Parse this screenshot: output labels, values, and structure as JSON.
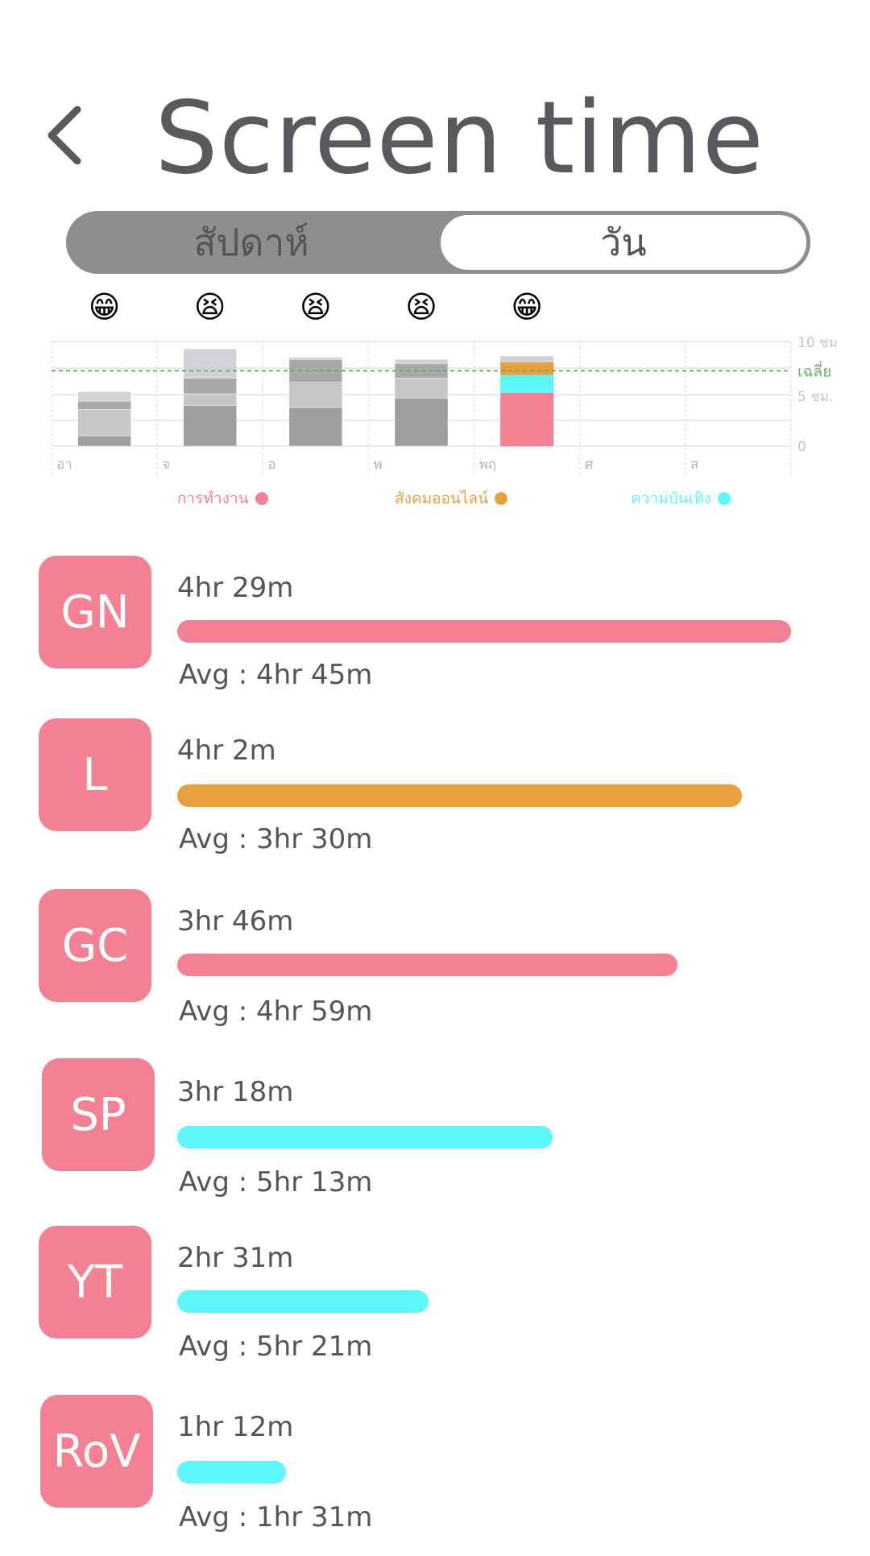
{
  "header": {
    "title": "Screen time",
    "back_icon": "chevron-left-icon"
  },
  "toggle": {
    "week_label": "สัปดาห์",
    "day_label": "วัน",
    "selected": "day"
  },
  "chart_data": {
    "type": "bar",
    "categories": [
      "อา",
      "จ",
      "อ",
      "พ",
      "พฤ",
      "ศ",
      "ส"
    ],
    "moods": [
      "😁",
      "😫",
      "😫",
      "😫",
      "😁",
      "",
      ""
    ],
    "y_unit": "ชม",
    "ylim": [
      0,
      10
    ],
    "y_ticks": [
      "10 ชม",
      "5 ชม.",
      "0"
    ],
    "average_label": "เฉลี่ย",
    "average_value": 7.2,
    "stacks": [
      [
        1.0,
        2.5,
        0.8,
        0.9
      ],
      [
        3.9,
        1.1,
        1.5,
        2.8
      ],
      [
        3.7,
        2.4,
        2.2,
        0.2
      ],
      [
        4.6,
        1.9,
        1.4,
        0.4
      ],
      [],
      [],
      []
    ],
    "highlight_day_index": 4,
    "highlight_stack": [
      {
        "category": "การทำงาน",
        "value": 5.1
      },
      {
        "category": "ความบันเทิง",
        "value": 1.7
      },
      {
        "category": "สังคมออนไลน์",
        "value": 1.2
      },
      {
        "category": "other",
        "value": 0.6
      }
    ],
    "colors": {
      "work": "#f48193",
      "social": "#e8a03d",
      "entertainment": "#5cf6fb",
      "past": [
        "#9e9e9e",
        "#c6c6c6",
        "#a9a9a9",
        "#d2d2d6"
      ],
      "average_line": "#6aae6a"
    }
  },
  "legend": [
    {
      "label": "การทำงาน",
      "color": "#f48193"
    },
    {
      "label": "สังคมออนไลน์",
      "color": "#e8a03d"
    },
    {
      "label": "ความบันเทิง",
      "color": "#5cf6fb"
    }
  ],
  "apps": [
    {
      "badge": "GN",
      "time": "4hr 29m",
      "avg": "Avg : 4hr 45m",
      "color": "#f48193",
      "fraction": 1.0
    },
    {
      "badge": "L",
      "time": "4hr 2m",
      "avg": "Avg : 3hr 30m",
      "color": "#e8a03d",
      "fraction": 0.92
    },
    {
      "badge": "GC",
      "time": "3hr 46m",
      "avg": "Avg : 4hr 59m",
      "color": "#f48193",
      "fraction": 0.815
    },
    {
      "badge": "SP",
      "time": "3hr 18m",
      "avg": "Avg : 5hr 13m",
      "color": "#5cf6fb",
      "fraction": 0.612
    },
    {
      "badge": "YT",
      "time": "2hr 31m",
      "avg": "Avg : 5hr 21m",
      "color": "#5cf6fb",
      "fraction": 0.41
    },
    {
      "badge": "RoV",
      "time": "1hr 12m",
      "avg": "Avg : 1hr 31m",
      "color": "#5cf6fb",
      "fraction": 0.177
    }
  ]
}
